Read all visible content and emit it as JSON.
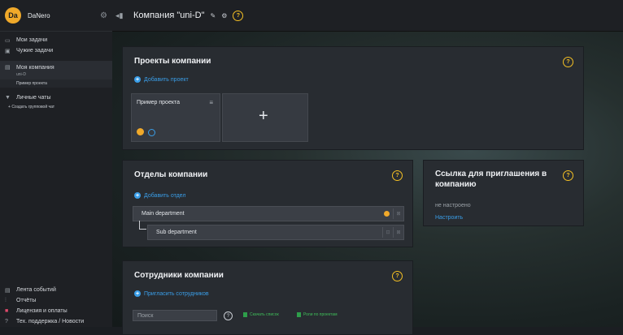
{
  "sidebar": {
    "user": {
      "initials": "Da",
      "name": "DaNero"
    },
    "top_items": [
      {
        "icon": "chat-bubble-icon",
        "label": "Мои задачи"
      },
      {
        "icon": "inbox-icon",
        "label": "Чужие задачи"
      }
    ],
    "company": {
      "label": "Моя компания",
      "sub": "uni-D",
      "project": "Пример проекта"
    },
    "chats": {
      "label": "Личные чаты",
      "create": "Создать групповой чат"
    },
    "bottom_items": [
      {
        "icon": "feed-icon",
        "label": "Лента событий"
      },
      {
        "icon": "chart-icon",
        "label": "Отчёты"
      },
      {
        "icon": "license-icon",
        "label": "Лицензия и оплаты"
      },
      {
        "icon": "help-icon",
        "label": "Тех. поддержка / Новости"
      }
    ]
  },
  "header": {
    "title": "Компания \"uni-D\""
  },
  "projects": {
    "title": "Проекты компании",
    "add_label": "Добавить проект",
    "cards": [
      {
        "name": "Пример проекта"
      }
    ]
  },
  "departments": {
    "title": "Отделы компании",
    "add_label": "Добавить отдел",
    "items": [
      {
        "name": "Main department"
      },
      {
        "name": "Sub department"
      }
    ]
  },
  "invite": {
    "title": "Ссылка для приглашения в компанию",
    "status": "не настроено",
    "configure_label": "Настроить"
  },
  "employees": {
    "title": "Сотрудники компании",
    "invite_label": "Пригласить сотрудников",
    "search_placeholder": "Поиск",
    "download_label": "Скачать список",
    "roles_label": "Роли по проектам"
  },
  "colors": {
    "accent": "#3a9ee8",
    "avatar": "#f0a92a",
    "help": "#f5c024",
    "excel": "#3fbf5a"
  }
}
